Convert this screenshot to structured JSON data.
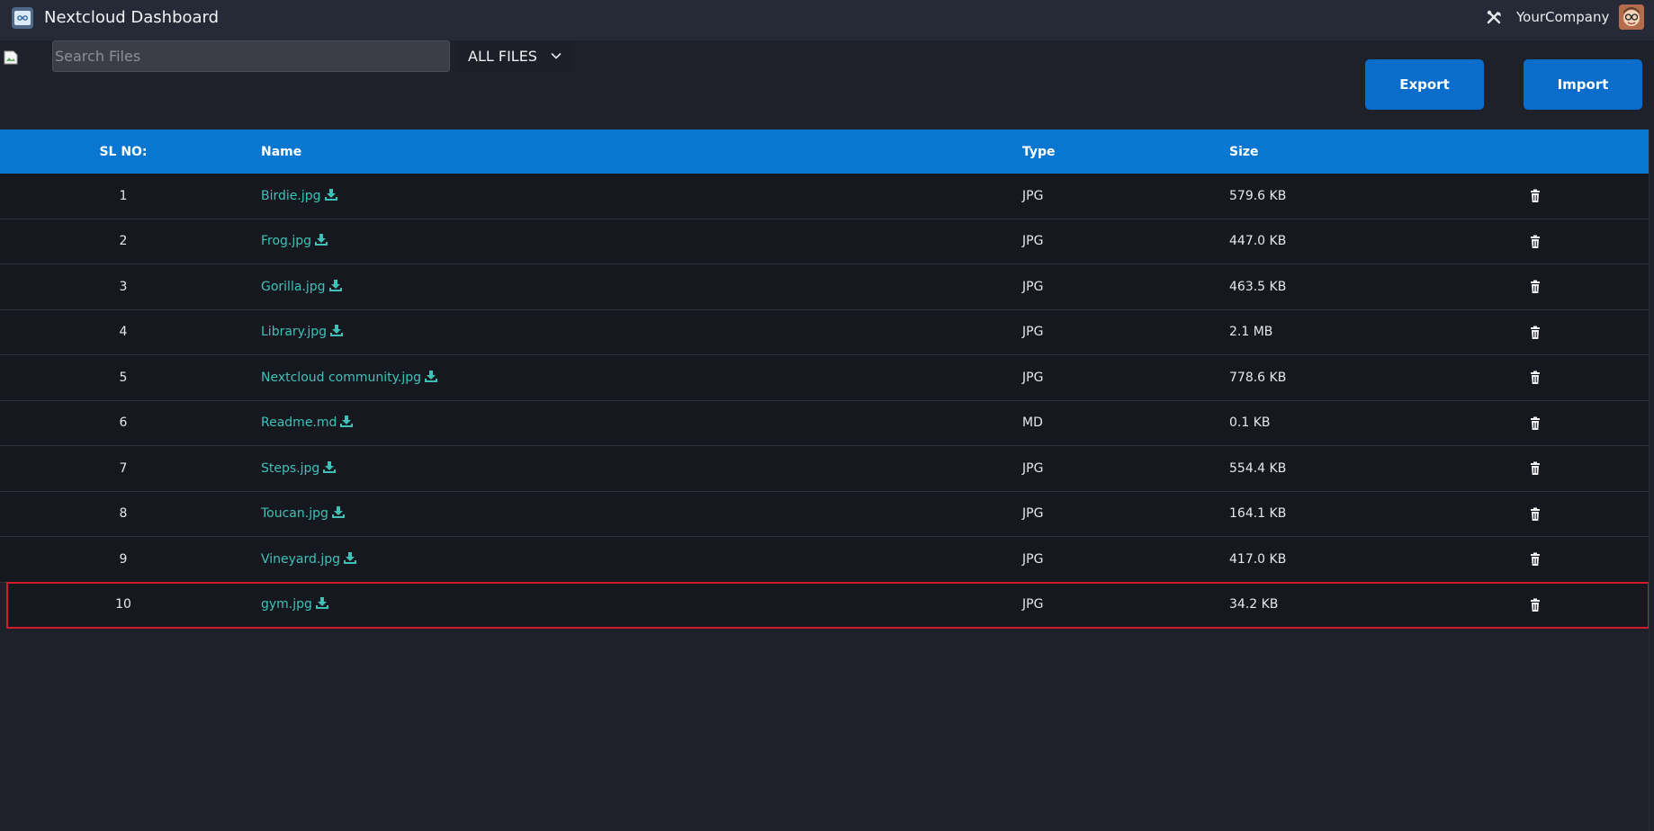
{
  "navbar": {
    "title": "Nextcloud Dashboard",
    "company": "YourCompany",
    "icons": [
      "app-logo-icon",
      "tools-icon",
      "avatar"
    ]
  },
  "toolbar": {
    "search_placeholder": "Search Files",
    "search_value": "",
    "filter_label": "ALL FILES",
    "export_label": "Export",
    "import_label": "Import"
  },
  "table": {
    "headers": [
      "SL NO:",
      "Name",
      "Type",
      "Size"
    ],
    "rows": [
      {
        "sl": "1",
        "name": "Birdie.jpg",
        "type": "JPG",
        "size": "579.6 KB"
      },
      {
        "sl": "2",
        "name": "Frog.jpg",
        "type": "JPG",
        "size": "447.0 KB"
      },
      {
        "sl": "3",
        "name": "Gorilla.jpg",
        "type": "JPG",
        "size": "463.5 KB"
      },
      {
        "sl": "4",
        "name": "Library.jpg",
        "type": "JPG",
        "size": "2.1 MB"
      },
      {
        "sl": "5",
        "name": "Nextcloud community.jpg",
        "type": "JPG",
        "size": "778.6 KB"
      },
      {
        "sl": "6",
        "name": "Readme.md",
        "type": "MD",
        "size": "0.1 KB"
      },
      {
        "sl": "7",
        "name": "Steps.jpg",
        "type": "JPG",
        "size": "554.4 KB"
      },
      {
        "sl": "8",
        "name": "Toucan.jpg",
        "type": "JPG",
        "size": "164.1 KB"
      },
      {
        "sl": "9",
        "name": "Vineyard.jpg",
        "type": "JPG",
        "size": "417.0 KB"
      },
      {
        "sl": "10",
        "name": "gym.jpg",
        "type": "JPG",
        "size": "34.2 KB"
      }
    ],
    "highlighted_row": 9
  },
  "colors": {
    "accent": "#0877d1",
    "button": "#0a6ccb",
    "link": "#3fc1b8",
    "highlight": "#d11b2c",
    "background": "#1e2129"
  }
}
